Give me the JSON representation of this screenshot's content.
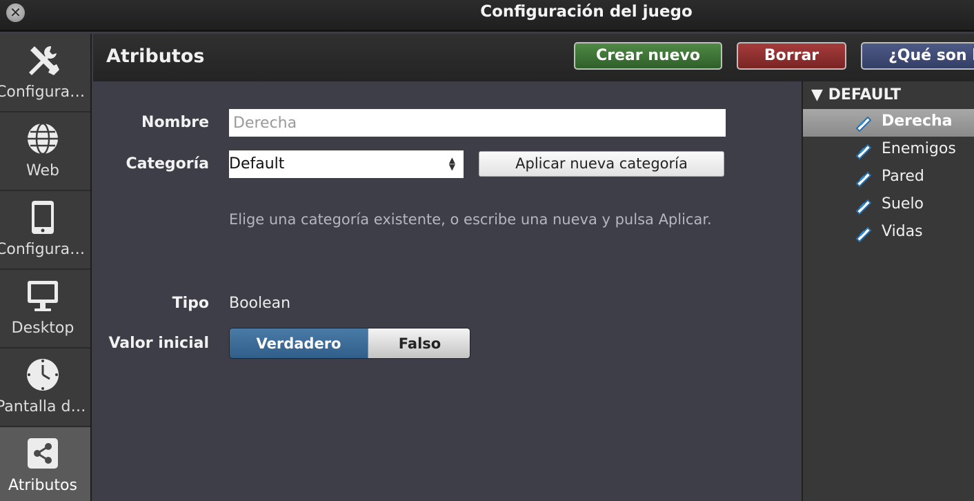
{
  "window": {
    "title": "Configuración del juego",
    "close_glyph": "✕"
  },
  "sidebar": {
    "items": [
      {
        "label": "Configuración",
        "icon": "wrench-icon",
        "active": false
      },
      {
        "label": "Web",
        "icon": "globe-icon",
        "active": false
      },
      {
        "label": "Configuración",
        "icon": "tablet-icon",
        "active": false
      },
      {
        "label": "Desktop",
        "icon": "monitor-icon",
        "active": false
      },
      {
        "label": "Pantalla de carga",
        "icon": "clock-icon",
        "active": false
      },
      {
        "label": "Atributos",
        "icon": "share-icon",
        "active": true
      }
    ]
  },
  "header": {
    "title": "Atributos",
    "create_label": "Crear nuevo",
    "delete_label": "Borrar",
    "help_label": "¿Qué son los atributos?"
  },
  "form": {
    "name_label": "Nombre",
    "name_placeholder": "Derecha",
    "category_label": "Categoría",
    "category_value": "Default",
    "apply_label": "Aplicar nueva categoría",
    "hint": "Elige una categoría existente, o escribe una nueva y pulsa Aplicar.",
    "type_label": "Tipo",
    "type_value": "Boolean",
    "initial_label": "Valor inicial",
    "true_label": "Verdadero",
    "false_label": "Falso",
    "selected_value": "Verdadero"
  },
  "tree": {
    "group": "DEFAULT",
    "expand_glyph": "▼",
    "items": [
      {
        "label": "Derecha",
        "selected": true
      },
      {
        "label": "Enemigos",
        "selected": false
      },
      {
        "label": "Pared",
        "selected": false
      },
      {
        "label": "Suelo",
        "selected": false
      },
      {
        "label": "Vidas",
        "selected": false
      }
    ]
  },
  "colors": {
    "create_button": "#3f7537",
    "delete_button": "#8e2f2f",
    "help_button": "#3f4a73",
    "toggle_active": "#3b6b96",
    "panel_bg": "#3e3e48"
  }
}
